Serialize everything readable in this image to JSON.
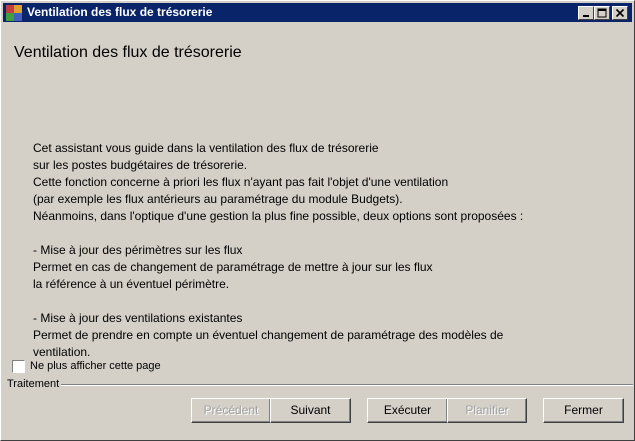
{
  "window": {
    "title": "Ventilation des flux de trésorerie",
    "controls": {
      "minimize": "minimize-icon",
      "maximize": "maximize-icon",
      "close": "close-icon"
    }
  },
  "page": {
    "heading": "Ventilation des flux de trésorerie",
    "description_lines": [
      "Cet assistant vous guide dans la ventilation des flux de trésorerie",
      "sur les postes budgétaires de trésorerie.",
      "Cette fonction concerne à priori les flux n'ayant pas fait l'objet d'une ventilation",
      "(par exemple les flux antérieurs au paramétrage du module Budgets).",
      "Néanmoins, dans l'optique d'une gestion la plus fine possible, deux options sont proposées :",
      "",
      "- Mise à jour des périmètres sur les flux",
      "Permet en cas de changement de paramétrage de mettre à jour sur les flux",
      "la référence à un éventuel périmètre.",
      "",
      "- Mise à jour des ventilations existantes",
      "Permet de prendre en compte un éventuel changement de paramétrage des modèles de",
      "ventilation."
    ]
  },
  "options": {
    "hide_page_label": "Ne plus afficher cette page",
    "hide_page_checked": false
  },
  "footer": {
    "group_label": "Traitement",
    "buttons": {
      "previous": "Précédent",
      "next": "Suivant",
      "execute": "Exécuter",
      "schedule": "Planifier",
      "close": "Fermer"
    }
  },
  "colors": {
    "titlebar": "#0a246a",
    "window_bg": "#d4d0c8",
    "disabled_text": "#a0a0a0"
  }
}
